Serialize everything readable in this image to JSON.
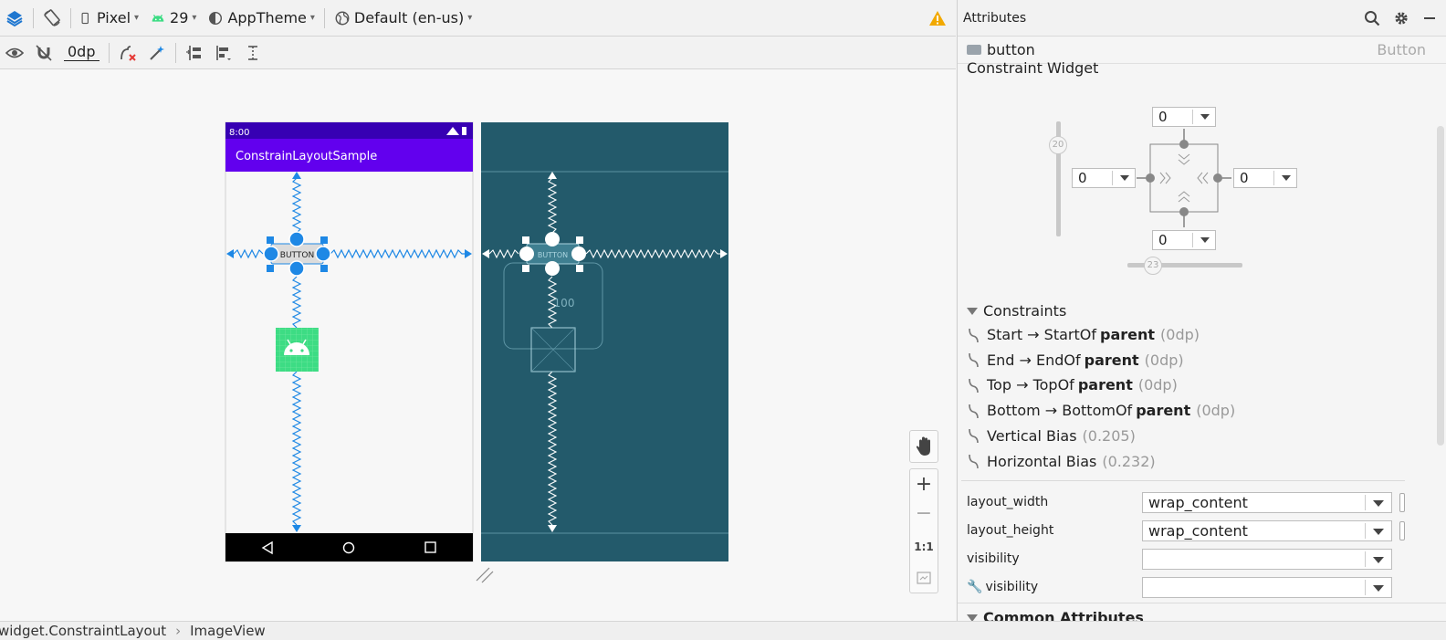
{
  "toolbar": {
    "device": "Pixel",
    "api_level": "29",
    "theme": "AppTheme",
    "locale": "Default (en-us)",
    "margin": "0dp"
  },
  "phone": {
    "status_time": "8:00",
    "app_title": "ConstrainLayoutSample",
    "button_label": "BUTTON"
  },
  "blueprint": {
    "button_label": "BUTTON",
    "bias_label": "100"
  },
  "zoom": {
    "ratio_label": "1:1"
  },
  "attributes": {
    "title": "Attributes",
    "component_name": "button",
    "component_class": "Button",
    "section_constraint_widget": "Constraint Widget",
    "widget": {
      "top_margin": "0",
      "left_margin": "0",
      "right_margin": "0",
      "bottom_margin": "0",
      "vertical_bias_value": "20",
      "horizontal_bias_value": "23"
    },
    "constraints_header": "Constraints",
    "constraints": [
      {
        "text": "Start → StartOf",
        "target": "parent",
        "value": "(0dp)"
      },
      {
        "text": "End → EndOf",
        "target": "parent",
        "value": "(0dp)"
      },
      {
        "text": "Top → TopOf",
        "target": "parent",
        "value": "(0dp)"
      },
      {
        "text": "Bottom → BottomOf",
        "target": "parent",
        "value": "(0dp)"
      },
      {
        "text": "Vertical Bias",
        "target": "",
        "value": "(0.205)"
      },
      {
        "text": "Horizontal Bias",
        "target": "",
        "value": "(0.232)"
      }
    ],
    "properties": [
      {
        "label": "layout_width",
        "value": "wrap_content"
      },
      {
        "label": "layout_height",
        "value": "wrap_content"
      },
      {
        "label": "visibility",
        "value": ""
      },
      {
        "label": "visibility",
        "value": ""
      }
    ],
    "next_section": "Common Attributes"
  },
  "statusbar": {
    "crumb1": "widget.ConstraintLayout",
    "crumb2": "ImageView"
  },
  "colors": {
    "accent_blue": "#1e88e5",
    "app_bar": "#6200ee",
    "status_bar": "#3700b3",
    "blueprint_bg": "#235a6b",
    "warning": "#f2a900"
  }
}
